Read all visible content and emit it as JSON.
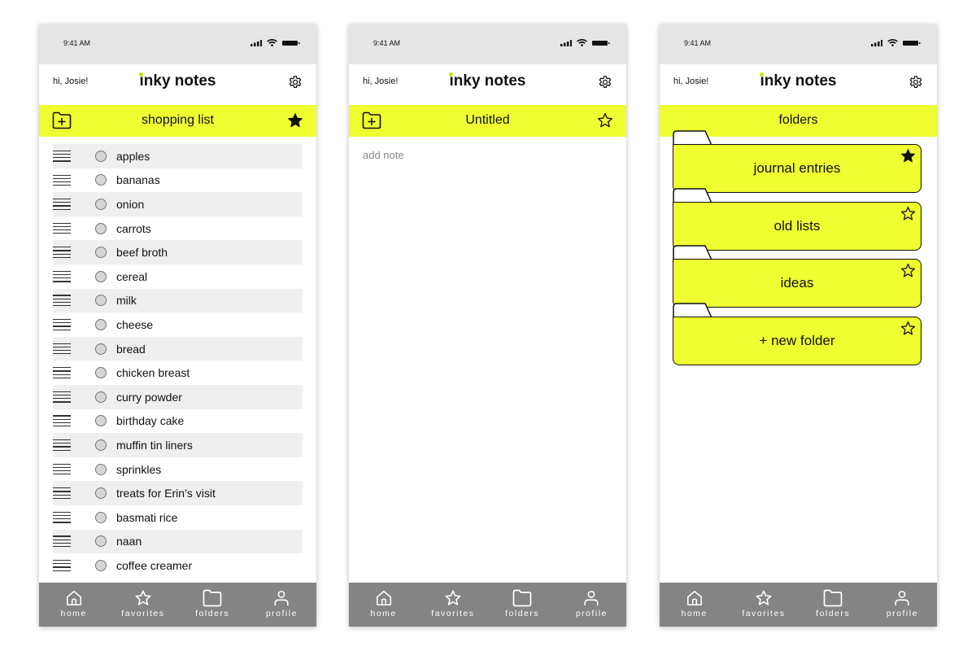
{
  "status_time": "9:41 AM",
  "greeting": "hi, Josie!",
  "app_name": "inky notes",
  "accent_color": "#eefe30",
  "nav": [
    {
      "label": "home",
      "icon": "home-icon"
    },
    {
      "label": "favorites",
      "icon": "star-icon"
    },
    {
      "label": "folders",
      "icon": "folder-icon"
    },
    {
      "label": "profile",
      "icon": "person-icon"
    }
  ],
  "screens": [
    {
      "banner_title": "shopping list",
      "favorited": true,
      "items": [
        "apples",
        "bananas",
        "onion",
        "carrots",
        "beef broth",
        "cereal",
        "milk",
        "cheese",
        "bread",
        "chicken breast",
        "curry powder",
        "birthday cake",
        "muffin tin liners",
        "sprinkles",
        "treats for Erin’s visit",
        "basmati rice",
        "naan",
        "coffee creamer"
      ]
    },
    {
      "banner_title": "Untitled",
      "favorited": false,
      "note_placeholder": "add note"
    },
    {
      "banner_title": "folders",
      "folders": [
        {
          "label": "journal entries",
          "favorited": true
        },
        {
          "label": "old lists",
          "favorited": false
        },
        {
          "label": "ideas",
          "favorited": false
        },
        {
          "label": "+ new folder",
          "favorited": false
        }
      ]
    }
  ]
}
